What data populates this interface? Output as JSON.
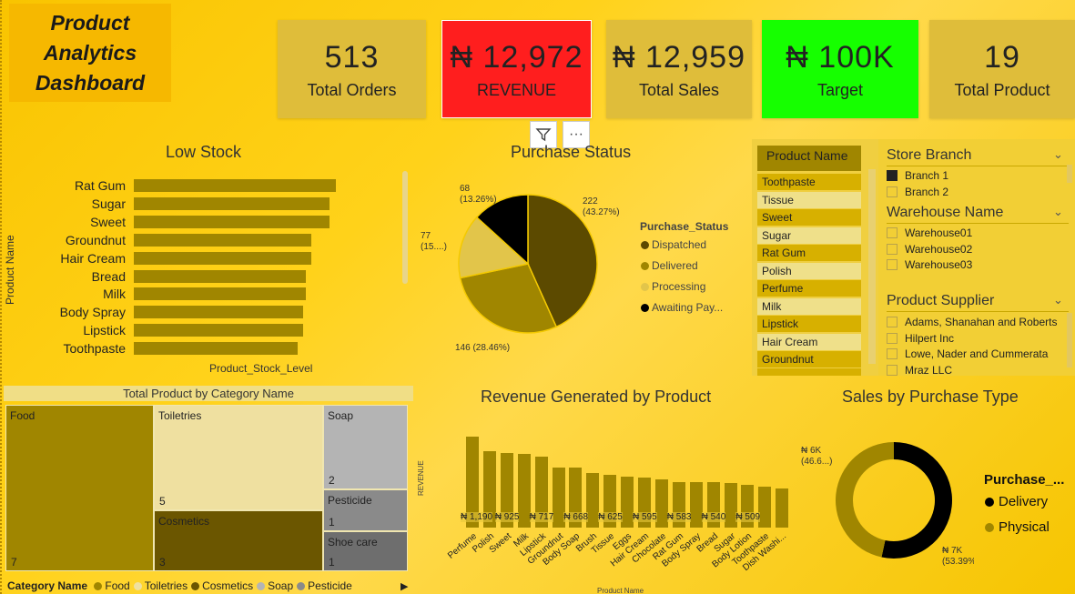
{
  "dashboard": {
    "title": "Product\nAnalytics\nDashboard"
  },
  "kpis": [
    {
      "value": "513",
      "label": "Total Orders",
      "color": "#dfbd3a"
    },
    {
      "value": "₦ 12,972",
      "label": "REVENUE",
      "color": "#ff1e1e"
    },
    {
      "value": "₦ 12,959",
      "label": "Total Sales",
      "color": "#dfbd3a"
    },
    {
      "value": "₦ 100K",
      "label": "Target",
      "color": "#16ff00"
    },
    {
      "value": "19",
      "label": "Total Product",
      "color": "#dfbd3a"
    }
  ],
  "low_stock": {
    "title": "Low Stock",
    "xlabel": "Product_Stock_Level",
    "ylabel": "Product Name",
    "chart_data": {
      "type": "bar",
      "categories": [
        "Rat Gum",
        "Sugar",
        "Sweet",
        "Groundnut",
        "Hair Cream",
        "Bread",
        "Milk",
        "Body Spray",
        "Lipstick",
        "Toothpaste"
      ],
      "values": [
        100,
        97,
        97,
        88,
        88,
        85,
        85,
        84,
        84,
        81
      ]
    }
  },
  "purchase_status": {
    "title": "Purchase Status",
    "legend_title": "Purchase_Status",
    "chart_data": {
      "type": "pie",
      "series": [
        {
          "name": "Dispatched",
          "value": 222,
          "label": "222\n(43.27%)",
          "color": "#5c4a00"
        },
        {
          "name": "Delivered",
          "value": 146,
          "label": "146 (28.46%)",
          "color": "#a08600"
        },
        {
          "name": "Processing",
          "value": 77,
          "label": "77\n(15....)",
          "color": "#e2c54a"
        },
        {
          "name": "Awaiting Pay...",
          "value": 68,
          "label": "68\n(13.26%)",
          "color": "#000000"
        }
      ]
    }
  },
  "product_slicer": {
    "header": "Product Name",
    "items": [
      "Toothpaste",
      "Tissue",
      "Sweet",
      "Sugar",
      "Rat Gum",
      "Polish",
      "Perfume",
      "Milk",
      "Lipstick",
      "Hair Cream",
      "Groundnut"
    ]
  },
  "store_branch": {
    "title": "Store Branch",
    "items": [
      "Branch 1",
      "Branch 2"
    ]
  },
  "warehouse": {
    "title": "Warehouse Name",
    "items": [
      "Warehouse01",
      "Warehouse02",
      "Warehouse03"
    ]
  },
  "supplier": {
    "title": "Product Supplier",
    "items": [
      "Adams, Shanahan and Roberts",
      "Hilpert Inc",
      "Lowe, Nader and Cummerata",
      "Mraz LLC"
    ]
  },
  "treemap": {
    "title": "Total Product by Category Name",
    "legend_title": "Category Name",
    "chart_data": {
      "type": "heatmap",
      "categories": [
        "Food",
        "Toiletries",
        "Cosmetics",
        "Soap",
        "Pesticide",
        "Shoe care"
      ],
      "values": [
        7,
        5,
        3,
        2,
        1,
        1
      ]
    },
    "legend": [
      {
        "name": "Food",
        "color": "#a08600"
      },
      {
        "name": "Toiletries",
        "color": "#efe0a0"
      },
      {
        "name": "Cosmetics",
        "color": "#6b5600"
      },
      {
        "name": "Soap",
        "color": "#b4b4b4"
      },
      {
        "name": "Pesticide",
        "color": "#8a8a8a"
      }
    ]
  },
  "revenue": {
    "title": "Revenue Generated by Product",
    "ylabel": "REVENUE",
    "xlabel": "Product Name",
    "chart_data": {
      "type": "bar",
      "categories": [
        "Perfume",
        "Polish",
        "Sweet",
        "Milk",
        "Lipstick",
        "Groundnut",
        "Body Soap",
        "Brush",
        "Tissue",
        "Eggs",
        "Hair Cream",
        "Chocolate",
        "Rat Gum",
        "Body Spray",
        "Bread",
        "Sugar",
        "Body Lotion",
        "Toothpaste",
        "Dish Washi..."
      ],
      "values": [
        1190,
        1000,
        980,
        960,
        925,
        790,
        780,
        717,
        690,
        668,
        660,
        625,
        600,
        595,
        590,
        583,
        560,
        540,
        509
      ],
      "data_labels": [
        "₦ 1,190",
        "₦ 925",
        "₦ 717",
        "₦ 668",
        "₦ 625",
        "₦ 595",
        "₦ 583",
        "₦ 540",
        "₦ 509"
      ]
    }
  },
  "sales_type": {
    "title": "Sales by Purchase Type",
    "legend_title": "Purchase_...",
    "chart_data": {
      "type": "pie",
      "series": [
        {
          "name": "Delivery",
          "value": 53.39,
          "label": "₦ 7K\n(53.39%)",
          "color": "#000000"
        },
        {
          "name": "Physical",
          "value": 46.61,
          "label": "₦ 6K\n(46.6...)",
          "color": "#a08600"
        }
      ]
    }
  }
}
